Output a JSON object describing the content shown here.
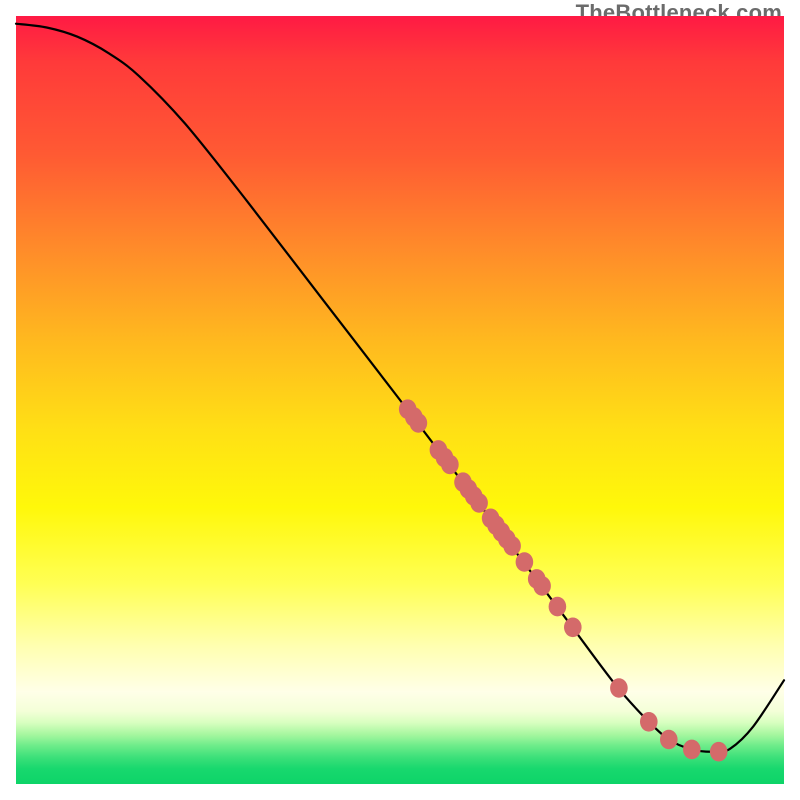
{
  "watermark": "TheBottleneck.com",
  "colors": {
    "curve": "#000000",
    "dot_fill": "#d46a6a",
    "gradient_top": "#ff1a44",
    "gradient_mid": "#ffe015",
    "gradient_green": "#0dd468"
  },
  "chart_data": {
    "type": "line",
    "title": "",
    "xlabel": "",
    "ylabel": "",
    "xlim": [
      0,
      100
    ],
    "ylim": [
      0,
      100
    ],
    "grid": false,
    "legend": false,
    "curve": [
      {
        "x": 0,
        "y": 99
      },
      {
        "x": 4,
        "y": 98.5
      },
      {
        "x": 8,
        "y": 97.3
      },
      {
        "x": 12,
        "y": 95.2
      },
      {
        "x": 16,
        "y": 92.2
      },
      {
        "x": 22,
        "y": 86.0
      },
      {
        "x": 30,
        "y": 76.0
      },
      {
        "x": 40,
        "y": 63.0
      },
      {
        "x": 50,
        "y": 50.0
      },
      {
        "x": 58,
        "y": 39.5
      },
      {
        "x": 66,
        "y": 29.0
      },
      {
        "x": 72,
        "y": 21.0
      },
      {
        "x": 78,
        "y": 13.0
      },
      {
        "x": 82,
        "y": 8.5
      },
      {
        "x": 85,
        "y": 5.8
      },
      {
        "x": 88,
        "y": 4.5
      },
      {
        "x": 91,
        "y": 4.2
      },
      {
        "x": 93,
        "y": 4.6
      },
      {
        "x": 96,
        "y": 7.5
      },
      {
        "x": 100,
        "y": 13.5
      }
    ],
    "markers": [
      {
        "x": 51.0,
        "y": 48.8
      },
      {
        "x": 51.8,
        "y": 47.8
      },
      {
        "x": 52.4,
        "y": 47.0
      },
      {
        "x": 55.0,
        "y": 43.5
      },
      {
        "x": 55.8,
        "y": 42.5
      },
      {
        "x": 56.5,
        "y": 41.6
      },
      {
        "x": 58.2,
        "y": 39.3
      },
      {
        "x": 58.9,
        "y": 38.4
      },
      {
        "x": 59.6,
        "y": 37.5
      },
      {
        "x": 60.3,
        "y": 36.6
      },
      {
        "x": 61.8,
        "y": 34.6
      },
      {
        "x": 62.5,
        "y": 33.7
      },
      {
        "x": 63.2,
        "y": 32.8
      },
      {
        "x": 63.9,
        "y": 31.9
      },
      {
        "x": 64.6,
        "y": 31.0
      },
      {
        "x": 66.2,
        "y": 28.9
      },
      {
        "x": 67.8,
        "y": 26.7
      },
      {
        "x": 68.5,
        "y": 25.8
      },
      {
        "x": 70.5,
        "y": 23.1
      },
      {
        "x": 72.5,
        "y": 20.4
      },
      {
        "x": 78.5,
        "y": 12.5
      },
      {
        "x": 82.4,
        "y": 8.1
      },
      {
        "x": 85.0,
        "y": 5.8
      },
      {
        "x": 88.0,
        "y": 4.5
      },
      {
        "x": 91.5,
        "y": 4.2
      }
    ]
  }
}
